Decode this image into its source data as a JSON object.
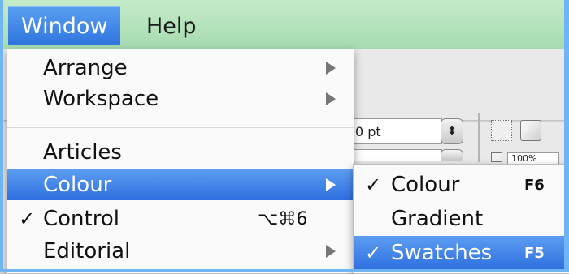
{
  "menubar": {
    "items": [
      {
        "label": "Window",
        "active": true
      },
      {
        "label": "Help",
        "active": false
      }
    ]
  },
  "toolbar": {
    "stroke_weight_value": "0 pt",
    "scale_value": "100%"
  },
  "window_menu": {
    "items": [
      {
        "label": "Arrange",
        "submenu": true
      },
      {
        "label": "Workspace",
        "submenu": true
      },
      {
        "label": "Articles",
        "submenu": false
      },
      {
        "label": "Colour",
        "submenu": true,
        "highlighted": true
      },
      {
        "label": "Control",
        "checked": true,
        "shortcut": "⌥⌘6"
      },
      {
        "label": "Editorial",
        "submenu": true
      }
    ],
    "check_glyph": "✓"
  },
  "colour_submenu": {
    "items": [
      {
        "label": "Colour",
        "checked": true,
        "shortcut": "F6"
      },
      {
        "label": "Gradient",
        "checked": false,
        "shortcut": ""
      },
      {
        "label": "Swatches",
        "checked": true,
        "shortcut": "F5",
        "highlighted": true
      }
    ],
    "check_glyph": "✓"
  },
  "colors": {
    "menubar_bg": "#b8e6bf",
    "highlight": "#3a7fe6",
    "frame_border": "#6fb5f5"
  }
}
